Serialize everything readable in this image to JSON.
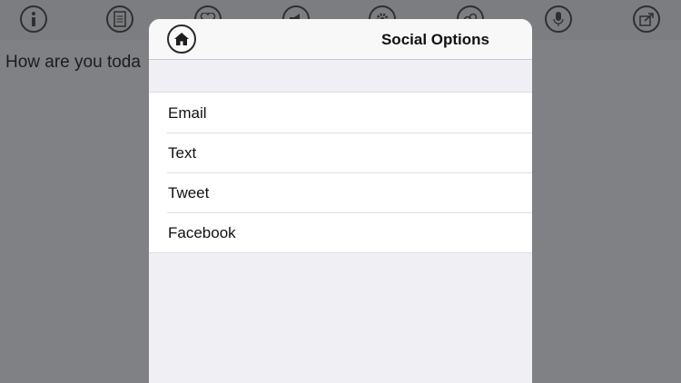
{
  "background": {
    "toolbar_icons": [
      "info-icon",
      "document-icon",
      "heart-icon",
      "megaphone-icon",
      "gear-icon",
      "link-icon",
      "microphone-icon",
      "share-icon"
    ],
    "text": "How are you toda"
  },
  "modal": {
    "title": "Social Options",
    "home_icon": "home-icon",
    "items": [
      {
        "label": "Email"
      },
      {
        "label": "Text"
      },
      {
        "label": "Tweet"
      },
      {
        "label": "Facebook"
      }
    ]
  },
  "colors": {
    "overlay": "#808184",
    "modal_bg": "#efeff4",
    "row_bg": "#ffffff",
    "separator": "#dcdce0"
  }
}
